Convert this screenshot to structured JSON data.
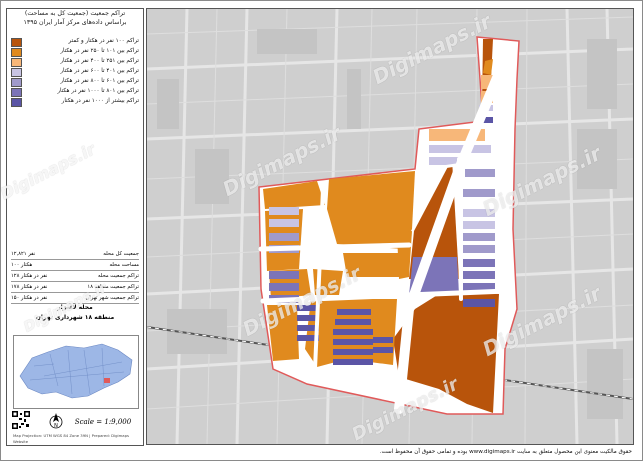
{
  "map_title": {
    "line1": "تراکم جمعیت (جمعیت کل به مساحت)",
    "line2": "براساس داده‌های مرکز آمار ایران ۱۳۹۵"
  },
  "legend": [
    {
      "label": "تراکم ۱۰۰ نفر در هکتار و کمتر",
      "color": "#b8540b"
    },
    {
      "label": "تراکم بین ۱۰۱ تا ۲۵۰ نفر در هکتار",
      "color": "#e08a1e"
    },
    {
      "label": "تراکم بین ۲۵۱ تا ۴۰۰ نفر در هکتار",
      "color": "#f7b779"
    },
    {
      "label": "تراکم بین ۴۰۱ تا ۶۰۰ نفر در هکتار",
      "color": "#c8c4e4"
    },
    {
      "label": "تراکم بین ۶۰۱ تا ۸۰۰ نفر در هکتار",
      "color": "#a09acb"
    },
    {
      "label": "تراکم بین ۸۰۱ تا ۱۰۰۰ نفر در هکتار",
      "color": "#7c74b8"
    },
    {
      "label": "تراکم بیشتر از ۱۰۰۰ نفر در هکتار",
      "color": "#5b55a6"
    }
  ],
  "stats": [
    {
      "label": "جمعیت کل محله",
      "value": "۱۲,۸۲۱ نفر"
    },
    {
      "label": "مساحت محله",
      "value": "۱۰۰ هکتار"
    },
    {
      "label": "تراکم جمعیت محله",
      "value": "۱۲۸ نفر در هکتار"
    },
    {
      "label": "تراکم جمعیت منطقه ۱۸",
      "value": "۱۷۸ نفر در هکتار"
    },
    {
      "label": "تراکم جمعیت شهر تهران",
      "value": "۱۵۰ نفر در هکتار"
    }
  ],
  "district": {
    "line1": "محله لاله‌زار",
    "line2": "منطقه ۱۸ شهرداری تهران"
  },
  "scale_text": "Scale = 1:9,000",
  "footnote": "Map Projection: UTM WGS 84 Zone 39N | Prepared: Digimaps Website",
  "footer_text": "حقوق مالکیت معنوی این محصول متعلق به سایت www.digimaps.ir بوده و تمامی حقوق آن محفوظ است.",
  "watermark_text": "Digimaps.ir",
  "icons": {
    "north": "north-arrow-icon",
    "qr": "qr-code-icon"
  },
  "colors": {
    "boundary": "#e05a5a",
    "road": "#ffffff",
    "background_map": "#cfcfcf"
  }
}
